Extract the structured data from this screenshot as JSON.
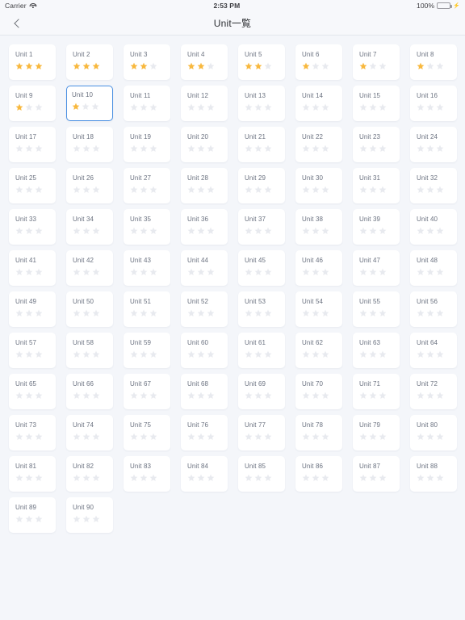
{
  "status_bar": {
    "carrier": "Carrier",
    "wifi_icon": "wifi-icon",
    "time": "2:53 PM",
    "battery_percent": "100%",
    "battery_level": 100,
    "battery_icon": "battery-icon",
    "charging_icon": "lightning-bolt-icon"
  },
  "navbar": {
    "back_icon": "chevron-left-icon",
    "title": "Unit一覧"
  },
  "grid": {
    "columns": 8,
    "max_stars": 3,
    "star_icon": "star-icon",
    "colors": {
      "background": "#f4f6fa",
      "card": "#ffffff",
      "label": "#6b7280",
      "star_filled": "#f8b83e",
      "star_empty": "#e8eaef",
      "selection_border": "#4a90e2"
    },
    "selected_unit": "Unit 10",
    "units": [
      {
        "label": "Unit 1",
        "stars": 3,
        "selected": false
      },
      {
        "label": "Unit 2",
        "stars": 3,
        "selected": false
      },
      {
        "label": "Unit 3",
        "stars": 2,
        "selected": false
      },
      {
        "label": "Unit 4",
        "stars": 2,
        "selected": false
      },
      {
        "label": "Unit 5",
        "stars": 2,
        "selected": false
      },
      {
        "label": "Unit 6",
        "stars": 1,
        "selected": false
      },
      {
        "label": "Unit 7",
        "stars": 1,
        "selected": false
      },
      {
        "label": "Unit 8",
        "stars": 1,
        "selected": false
      },
      {
        "label": "Unit 9",
        "stars": 1,
        "selected": false
      },
      {
        "label": "Unit 10",
        "stars": 1,
        "selected": true
      },
      {
        "label": "Unit 11",
        "stars": 0,
        "selected": false
      },
      {
        "label": "Unit 12",
        "stars": 0,
        "selected": false
      },
      {
        "label": "Unit 13",
        "stars": 0,
        "selected": false
      },
      {
        "label": "Unit 14",
        "stars": 0,
        "selected": false
      },
      {
        "label": "Unit 15",
        "stars": 0,
        "selected": false
      },
      {
        "label": "Unit 16",
        "stars": 0,
        "selected": false
      },
      {
        "label": "Unit 17",
        "stars": 0,
        "selected": false
      },
      {
        "label": "Unit 18",
        "stars": 0,
        "selected": false
      },
      {
        "label": "Unit 19",
        "stars": 0,
        "selected": false
      },
      {
        "label": "Unit 20",
        "stars": 0,
        "selected": false
      },
      {
        "label": "Unit 21",
        "stars": 0,
        "selected": false
      },
      {
        "label": "Unit 22",
        "stars": 0,
        "selected": false
      },
      {
        "label": "Unit 23",
        "stars": 0,
        "selected": false
      },
      {
        "label": "Unit 24",
        "stars": 0,
        "selected": false
      },
      {
        "label": "Unit 25",
        "stars": 0,
        "selected": false
      },
      {
        "label": "Unit 26",
        "stars": 0,
        "selected": false
      },
      {
        "label": "Unit 27",
        "stars": 0,
        "selected": false
      },
      {
        "label": "Unit 28",
        "stars": 0,
        "selected": false
      },
      {
        "label": "Unit 29",
        "stars": 0,
        "selected": false
      },
      {
        "label": "Unit 30",
        "stars": 0,
        "selected": false
      },
      {
        "label": "Unit 31",
        "stars": 0,
        "selected": false
      },
      {
        "label": "Unit 32",
        "stars": 0,
        "selected": false
      },
      {
        "label": "Unit 33",
        "stars": 0,
        "selected": false
      },
      {
        "label": "Unit 34",
        "stars": 0,
        "selected": false
      },
      {
        "label": "Unit 35",
        "stars": 0,
        "selected": false
      },
      {
        "label": "Unit 36",
        "stars": 0,
        "selected": false
      },
      {
        "label": "Unit 37",
        "stars": 0,
        "selected": false
      },
      {
        "label": "Unit 38",
        "stars": 0,
        "selected": false
      },
      {
        "label": "Unit 39",
        "stars": 0,
        "selected": false
      },
      {
        "label": "Unit 40",
        "stars": 0,
        "selected": false
      },
      {
        "label": "Unit 41",
        "stars": 0,
        "selected": false
      },
      {
        "label": "Unit 42",
        "stars": 0,
        "selected": false
      },
      {
        "label": "Unit 43",
        "stars": 0,
        "selected": false
      },
      {
        "label": "Unit 44",
        "stars": 0,
        "selected": false
      },
      {
        "label": "Unit 45",
        "stars": 0,
        "selected": false
      },
      {
        "label": "Unit 46",
        "stars": 0,
        "selected": false
      },
      {
        "label": "Unit 47",
        "stars": 0,
        "selected": false
      },
      {
        "label": "Unit 48",
        "stars": 0,
        "selected": false
      },
      {
        "label": "Unit 49",
        "stars": 0,
        "selected": false
      },
      {
        "label": "Unit 50",
        "stars": 0,
        "selected": false
      },
      {
        "label": "Unit 51",
        "stars": 0,
        "selected": false
      },
      {
        "label": "Unit 52",
        "stars": 0,
        "selected": false
      },
      {
        "label": "Unit 53",
        "stars": 0,
        "selected": false
      },
      {
        "label": "Unit 54",
        "stars": 0,
        "selected": false
      },
      {
        "label": "Unit 55",
        "stars": 0,
        "selected": false
      },
      {
        "label": "Unit 56",
        "stars": 0,
        "selected": false
      },
      {
        "label": "Unit 57",
        "stars": 0,
        "selected": false
      },
      {
        "label": "Unit 58",
        "stars": 0,
        "selected": false
      },
      {
        "label": "Unit 59",
        "stars": 0,
        "selected": false
      },
      {
        "label": "Unit 60",
        "stars": 0,
        "selected": false
      },
      {
        "label": "Unit 61",
        "stars": 0,
        "selected": false
      },
      {
        "label": "Unit 62",
        "stars": 0,
        "selected": false
      },
      {
        "label": "Unit 63",
        "stars": 0,
        "selected": false
      },
      {
        "label": "Unit 64",
        "stars": 0,
        "selected": false
      },
      {
        "label": "Unit 65",
        "stars": 0,
        "selected": false
      },
      {
        "label": "Unit 66",
        "stars": 0,
        "selected": false
      },
      {
        "label": "Unit 67",
        "stars": 0,
        "selected": false
      },
      {
        "label": "Unit 68",
        "stars": 0,
        "selected": false
      },
      {
        "label": "Unit 69",
        "stars": 0,
        "selected": false
      },
      {
        "label": "Unit 70",
        "stars": 0,
        "selected": false
      },
      {
        "label": "Unit 71",
        "stars": 0,
        "selected": false
      },
      {
        "label": "Unit 72",
        "stars": 0,
        "selected": false
      },
      {
        "label": "Unit 73",
        "stars": 0,
        "selected": false
      },
      {
        "label": "Unit 74",
        "stars": 0,
        "selected": false
      },
      {
        "label": "Unit 75",
        "stars": 0,
        "selected": false
      },
      {
        "label": "Unit 76",
        "stars": 0,
        "selected": false
      },
      {
        "label": "Unit 77",
        "stars": 0,
        "selected": false
      },
      {
        "label": "Unit 78",
        "stars": 0,
        "selected": false
      },
      {
        "label": "Unit 79",
        "stars": 0,
        "selected": false
      },
      {
        "label": "Unit 80",
        "stars": 0,
        "selected": false
      },
      {
        "label": "Unit 81",
        "stars": 0,
        "selected": false
      },
      {
        "label": "Unit 82",
        "stars": 0,
        "selected": false
      },
      {
        "label": "Unit 83",
        "stars": 0,
        "selected": false
      },
      {
        "label": "Unit 84",
        "stars": 0,
        "selected": false
      },
      {
        "label": "Unit 85",
        "stars": 0,
        "selected": false
      },
      {
        "label": "Unit 86",
        "stars": 0,
        "selected": false
      },
      {
        "label": "Unit 87",
        "stars": 0,
        "selected": false
      },
      {
        "label": "Unit 88",
        "stars": 0,
        "selected": false
      },
      {
        "label": "Unit 89",
        "stars": 0,
        "selected": false
      },
      {
        "label": "Unit 90",
        "stars": 0,
        "selected": false
      }
    ]
  }
}
